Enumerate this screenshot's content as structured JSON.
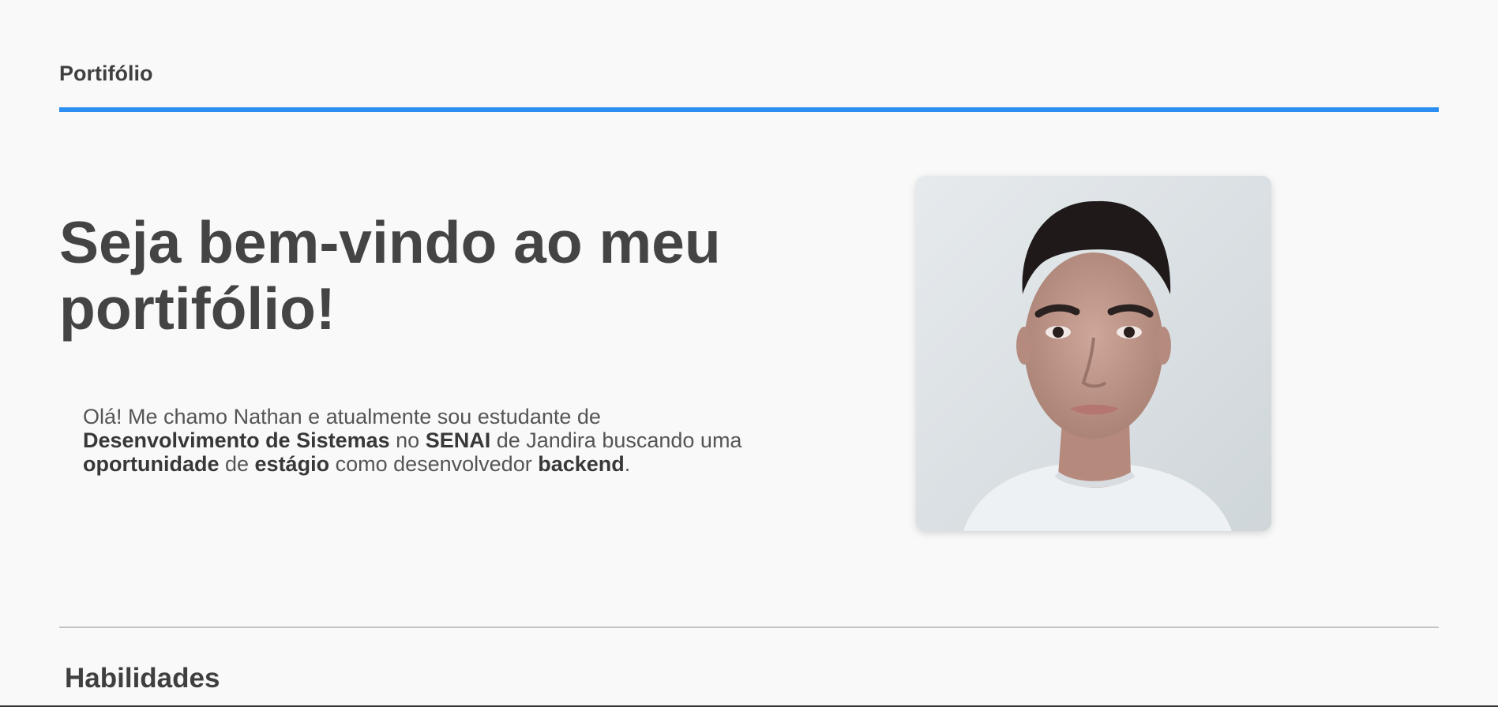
{
  "header": {
    "nav_title": "Portifólio",
    "accent_color": "#2b8ef0"
  },
  "hero": {
    "title": "Seja bem-vindo ao meu portifólio!",
    "intro": [
      {
        "text": "Olá! Me chamo Nathan e atualmente sou estudante de ",
        "bold": false
      },
      {
        "text": "Desenvolvimento de Sistemas",
        "bold": true
      },
      {
        "text": " no ",
        "bold": false
      },
      {
        "text": "SENAI",
        "bold": true
      },
      {
        "text": " de Jandira buscando uma ",
        "bold": false
      },
      {
        "text": "oportunidade",
        "bold": true
      },
      {
        "text": " de ",
        "bold": false
      },
      {
        "text": "estágio",
        "bold": true
      },
      {
        "text": " como desenvolvedor ",
        "bold": false
      },
      {
        "text": "backend",
        "bold": true
      },
      {
        "text": ".",
        "bold": false
      }
    ],
    "photo_icon": "profile-photo"
  },
  "sections": {
    "skills_title": "Habilidades"
  }
}
